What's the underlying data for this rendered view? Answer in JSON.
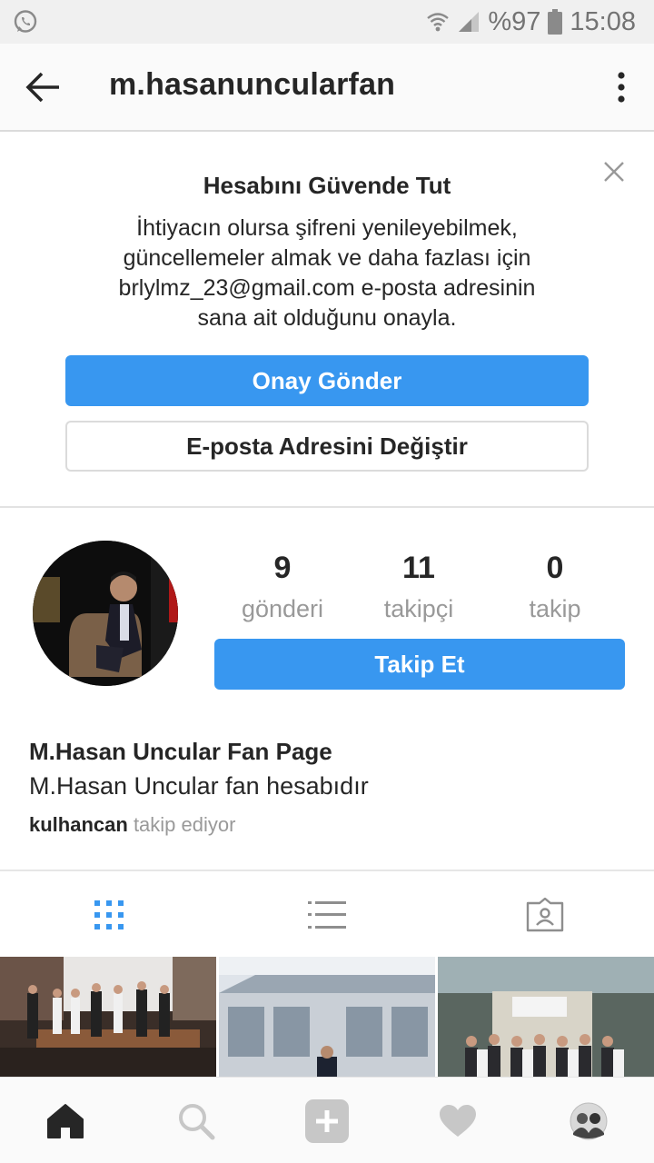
{
  "status_bar": {
    "battery": "%97",
    "time": "15:08",
    "icons": [
      "whatsapp-icon",
      "wifi-icon",
      "signal-icon",
      "battery-icon"
    ]
  },
  "header": {
    "username": "m.hasanuncularfan",
    "icons": [
      "back-arrow-icon",
      "more-vertical-icon"
    ]
  },
  "verify": {
    "title": "Hesabını Güvende Tut",
    "lines": [
      "İhtiyacın olursa şifreni yenileyebilmek,",
      "güncellemeler almak ve daha fazlası için",
      "brlylmz_23@gmail.com e-posta adresinin",
      "sana ait olduğunu onayla."
    ],
    "primary_button": "Onay Gönder",
    "secondary_button": "E-posta Adresini Değiştir"
  },
  "profile": {
    "stats": [
      {
        "value": "9",
        "label": "gönderi"
      },
      {
        "value": "11",
        "label": "takipçi"
      },
      {
        "value": "0",
        "label": "takip"
      }
    ],
    "follow_button": "Takip Et",
    "name": "M.Hasan Uncular Fan Page",
    "bio": "M.Hasan Uncular fan hesabıdır",
    "followed_by_user": "kulhancan",
    "followed_by_suffix": "takip ediyor"
  },
  "tabs": [
    "grid-icon",
    "list-icon",
    "tagged-icon"
  ],
  "bottom_nav": [
    "home-icon",
    "search-icon",
    "add-icon",
    "heart-icon",
    "profile-avatar-icon"
  ],
  "colors": {
    "accent": "#3897f0",
    "text": "#262626",
    "muted": "#999999"
  }
}
